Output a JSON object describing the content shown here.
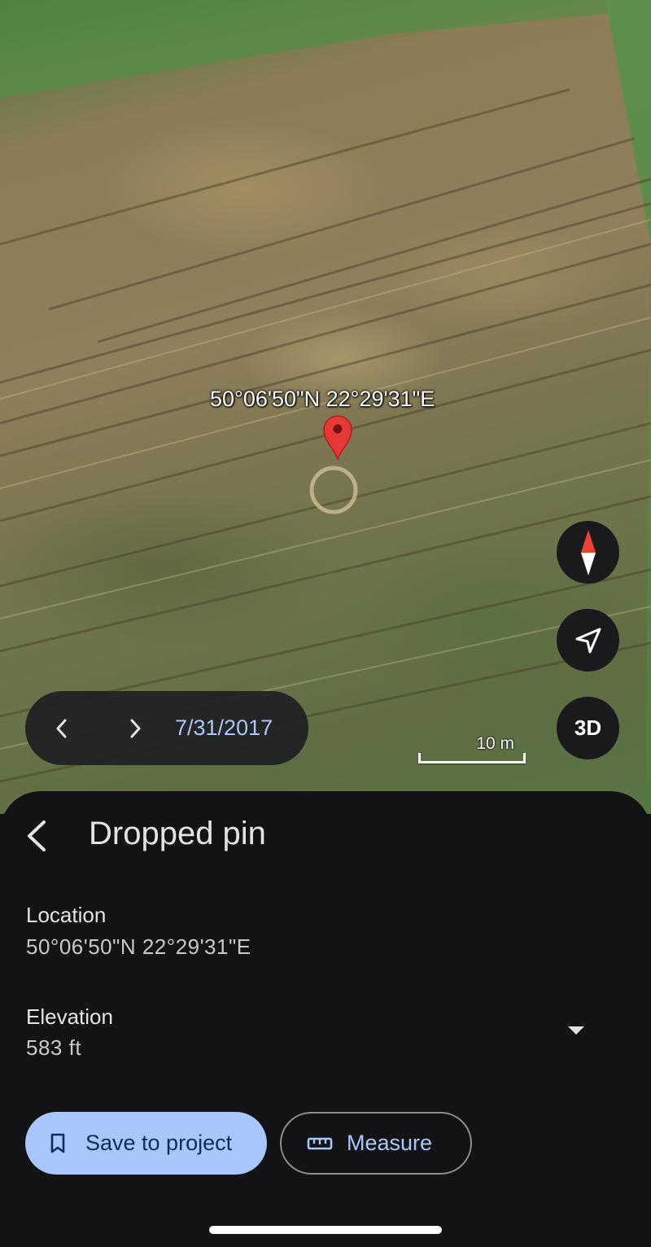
{
  "map": {
    "pin_coordinates_label": "50°06'50\"N 22°29'31\"E",
    "scale_label": "10 m",
    "controls": {
      "compass": "compass-icon",
      "locate": "navigation-arrow-icon",
      "three_d_label": "3D"
    },
    "imagery_date": "7/31/2017"
  },
  "sheet": {
    "title": "Dropped pin",
    "location_label": "Location",
    "location_value": "50°06'50\"N 22°29'31\"E",
    "elevation_label": "Elevation",
    "elevation_value": "583 ft",
    "save_button_label": "Save to project",
    "measure_button_label": "Measure"
  },
  "colors": {
    "accent": "#a8c7fa",
    "sheet_background": "#131316",
    "pin_red": "#e53935"
  }
}
